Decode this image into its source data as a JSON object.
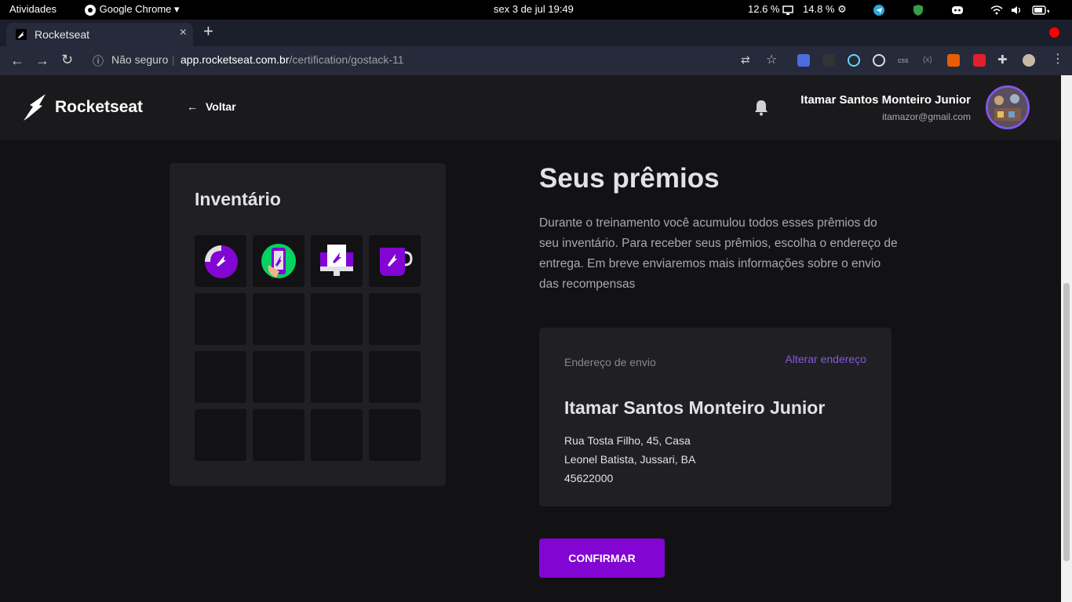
{
  "system_bar": {
    "activities": "Atividades",
    "app_name": "Google Chrome",
    "datetime": "sex 3 de jul  19:49",
    "cpu": "12.6 %",
    "mem": "14.8 %"
  },
  "browser": {
    "tab_title": "Rocketseat",
    "security_label": "Não seguro",
    "url_host": "app.rocketseat.com.br",
    "url_path": "/certification/gostack-11"
  },
  "header": {
    "brand": "Rocketseat",
    "back_label": "Voltar",
    "user_name": "Itamar Santos Monteiro Junior",
    "user_email": "itamazor@gmail.com"
  },
  "inventory": {
    "title": "Inventário",
    "items": [
      "sticker-icon",
      "phone-case-icon",
      "computer-icon",
      "mug-icon"
    ],
    "total_slots": 16
  },
  "main": {
    "title": "Seus prêmios",
    "description": "Durante o treinamento você acumulou todos esses prêmios do seu inventário. Para receber seus prêmios, escolha o endereço de entrega. Em breve enviaremos mais informações sobre o envio das recompensas",
    "confirm_label": "CONFIRMAR"
  },
  "address": {
    "label": "Endereço de envio",
    "change_label": "Alterar endereço",
    "name": "Itamar Santos Monteiro Junior",
    "line1": "Rua Tosta Filho, 45, Casa",
    "line2": "Leonel Batista, Jussari, BA",
    "zip": "45622000"
  },
  "colors": {
    "accent": "#8257e5",
    "button": "#8205d4",
    "background": "#121214",
    "card": "#202024"
  }
}
